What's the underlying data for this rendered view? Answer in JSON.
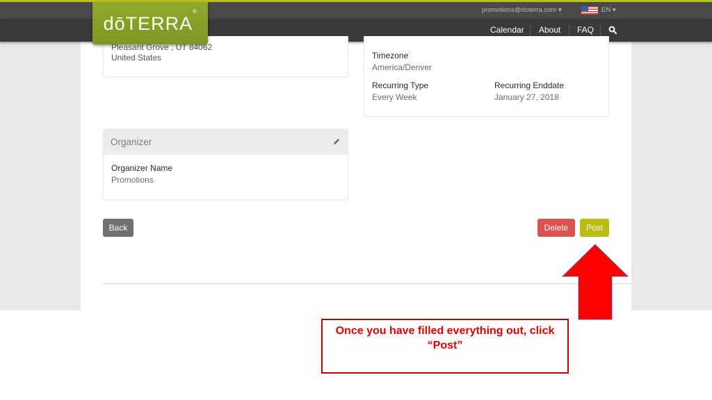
{
  "header": {
    "logo_text": "dōTERRA",
    "logo_mark": "®",
    "user_email": "promotions@doterra.com ▾",
    "flag_icon": "us-flag-icon",
    "language": "EN ▾",
    "nav": [
      {
        "label": "Calendar"
      },
      {
        "label": "About"
      },
      {
        "label": "FAQ"
      }
    ],
    "search_icon": "search-icon"
  },
  "location_card": {
    "address_line": "Pleasant Grove , UT 84062",
    "country": "United States"
  },
  "schedule_card": {
    "timezone_label": "Timezone",
    "timezone_value": "America/Denver",
    "recurring_type_label": "Recurring Type",
    "recurring_type_value": "Every Week",
    "recurring_enddate_label": "Recurring Enddate",
    "recurring_enddate_value": "January 27, 2018"
  },
  "organizer_card": {
    "title": "Organizer",
    "edit_icon": "pencil-icon",
    "name_label": "Organizer Name",
    "name_value": "Promotions"
  },
  "actions": {
    "back": "Back",
    "delete": "Delete",
    "post": "Post"
  },
  "colors": {
    "brand_green": "#7f9b25",
    "post_button": "#bcbd14",
    "delete_button": "#d9534f",
    "back_button": "#707070",
    "annotation_red": "#ff0000"
  },
  "annotation": {
    "arrow_icon": "up-arrow-icon",
    "text_line1": "Once you have filled everything out, click",
    "text_line2": "“Post”"
  }
}
